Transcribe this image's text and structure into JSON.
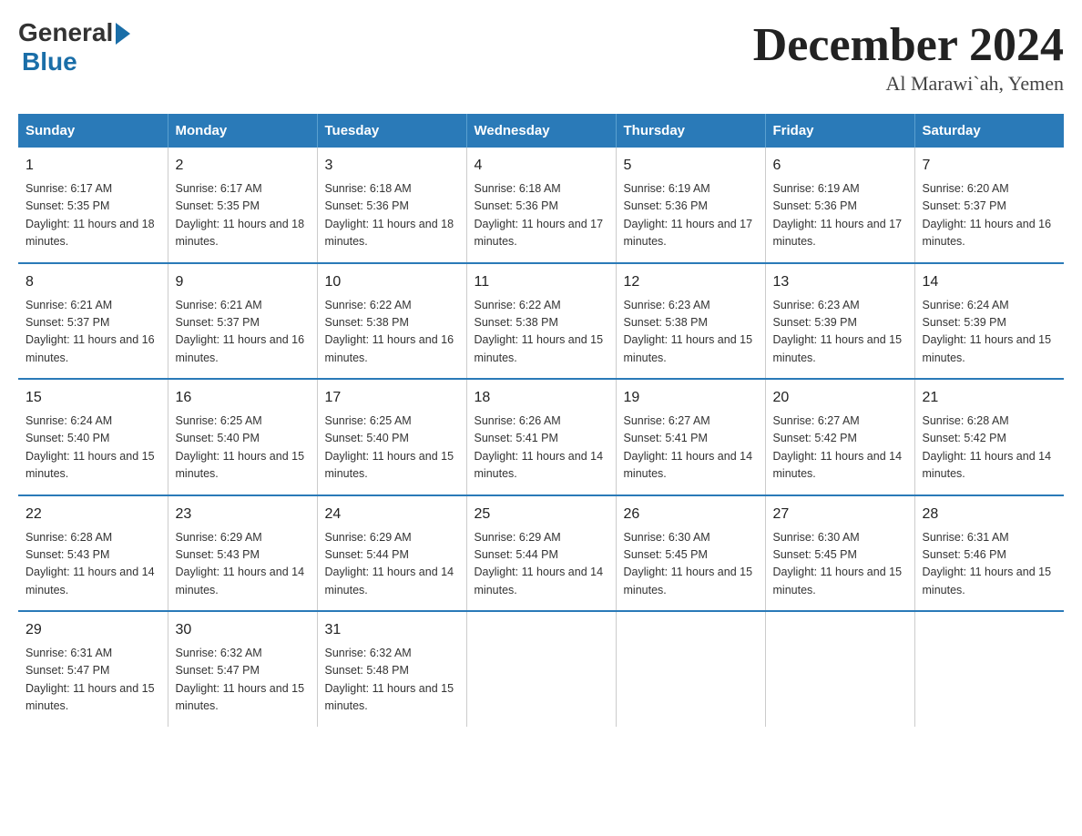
{
  "header": {
    "title": "December 2024",
    "subtitle": "Al Marawi`ah, Yemen",
    "logo": {
      "general": "General",
      "blue": "Blue"
    }
  },
  "weekdays": [
    "Sunday",
    "Monday",
    "Tuesday",
    "Wednesday",
    "Thursday",
    "Friday",
    "Saturday"
  ],
  "weeks": [
    [
      {
        "day": "1",
        "sunrise": "6:17 AM",
        "sunset": "5:35 PM",
        "daylight": "11 hours and 18 minutes."
      },
      {
        "day": "2",
        "sunrise": "6:17 AM",
        "sunset": "5:35 PM",
        "daylight": "11 hours and 18 minutes."
      },
      {
        "day": "3",
        "sunrise": "6:18 AM",
        "sunset": "5:36 PM",
        "daylight": "11 hours and 18 minutes."
      },
      {
        "day": "4",
        "sunrise": "6:18 AM",
        "sunset": "5:36 PM",
        "daylight": "11 hours and 17 minutes."
      },
      {
        "day": "5",
        "sunrise": "6:19 AM",
        "sunset": "5:36 PM",
        "daylight": "11 hours and 17 minutes."
      },
      {
        "day": "6",
        "sunrise": "6:19 AM",
        "sunset": "5:36 PM",
        "daylight": "11 hours and 17 minutes."
      },
      {
        "day": "7",
        "sunrise": "6:20 AM",
        "sunset": "5:37 PM",
        "daylight": "11 hours and 16 minutes."
      }
    ],
    [
      {
        "day": "8",
        "sunrise": "6:21 AM",
        "sunset": "5:37 PM",
        "daylight": "11 hours and 16 minutes."
      },
      {
        "day": "9",
        "sunrise": "6:21 AM",
        "sunset": "5:37 PM",
        "daylight": "11 hours and 16 minutes."
      },
      {
        "day": "10",
        "sunrise": "6:22 AM",
        "sunset": "5:38 PM",
        "daylight": "11 hours and 16 minutes."
      },
      {
        "day": "11",
        "sunrise": "6:22 AM",
        "sunset": "5:38 PM",
        "daylight": "11 hours and 15 minutes."
      },
      {
        "day": "12",
        "sunrise": "6:23 AM",
        "sunset": "5:38 PM",
        "daylight": "11 hours and 15 minutes."
      },
      {
        "day": "13",
        "sunrise": "6:23 AM",
        "sunset": "5:39 PM",
        "daylight": "11 hours and 15 minutes."
      },
      {
        "day": "14",
        "sunrise": "6:24 AM",
        "sunset": "5:39 PM",
        "daylight": "11 hours and 15 minutes."
      }
    ],
    [
      {
        "day": "15",
        "sunrise": "6:24 AM",
        "sunset": "5:40 PM",
        "daylight": "11 hours and 15 minutes."
      },
      {
        "day": "16",
        "sunrise": "6:25 AM",
        "sunset": "5:40 PM",
        "daylight": "11 hours and 15 minutes."
      },
      {
        "day": "17",
        "sunrise": "6:25 AM",
        "sunset": "5:40 PM",
        "daylight": "11 hours and 15 minutes."
      },
      {
        "day": "18",
        "sunrise": "6:26 AM",
        "sunset": "5:41 PM",
        "daylight": "11 hours and 14 minutes."
      },
      {
        "day": "19",
        "sunrise": "6:27 AM",
        "sunset": "5:41 PM",
        "daylight": "11 hours and 14 minutes."
      },
      {
        "day": "20",
        "sunrise": "6:27 AM",
        "sunset": "5:42 PM",
        "daylight": "11 hours and 14 minutes."
      },
      {
        "day": "21",
        "sunrise": "6:28 AM",
        "sunset": "5:42 PM",
        "daylight": "11 hours and 14 minutes."
      }
    ],
    [
      {
        "day": "22",
        "sunrise": "6:28 AM",
        "sunset": "5:43 PM",
        "daylight": "11 hours and 14 minutes."
      },
      {
        "day": "23",
        "sunrise": "6:29 AM",
        "sunset": "5:43 PM",
        "daylight": "11 hours and 14 minutes."
      },
      {
        "day": "24",
        "sunrise": "6:29 AM",
        "sunset": "5:44 PM",
        "daylight": "11 hours and 14 minutes."
      },
      {
        "day": "25",
        "sunrise": "6:29 AM",
        "sunset": "5:44 PM",
        "daylight": "11 hours and 14 minutes."
      },
      {
        "day": "26",
        "sunrise": "6:30 AM",
        "sunset": "5:45 PM",
        "daylight": "11 hours and 15 minutes."
      },
      {
        "day": "27",
        "sunrise": "6:30 AM",
        "sunset": "5:45 PM",
        "daylight": "11 hours and 15 minutes."
      },
      {
        "day": "28",
        "sunrise": "6:31 AM",
        "sunset": "5:46 PM",
        "daylight": "11 hours and 15 minutes."
      }
    ],
    [
      {
        "day": "29",
        "sunrise": "6:31 AM",
        "sunset": "5:47 PM",
        "daylight": "11 hours and 15 minutes."
      },
      {
        "day": "30",
        "sunrise": "6:32 AM",
        "sunset": "5:47 PM",
        "daylight": "11 hours and 15 minutes."
      },
      {
        "day": "31",
        "sunrise": "6:32 AM",
        "sunset": "5:48 PM",
        "daylight": "11 hours and 15 minutes."
      },
      {
        "day": "",
        "sunrise": "",
        "sunset": "",
        "daylight": ""
      },
      {
        "day": "",
        "sunrise": "",
        "sunset": "",
        "daylight": ""
      },
      {
        "day": "",
        "sunrise": "",
        "sunset": "",
        "daylight": ""
      },
      {
        "day": "",
        "sunrise": "",
        "sunset": "",
        "daylight": ""
      }
    ]
  ]
}
